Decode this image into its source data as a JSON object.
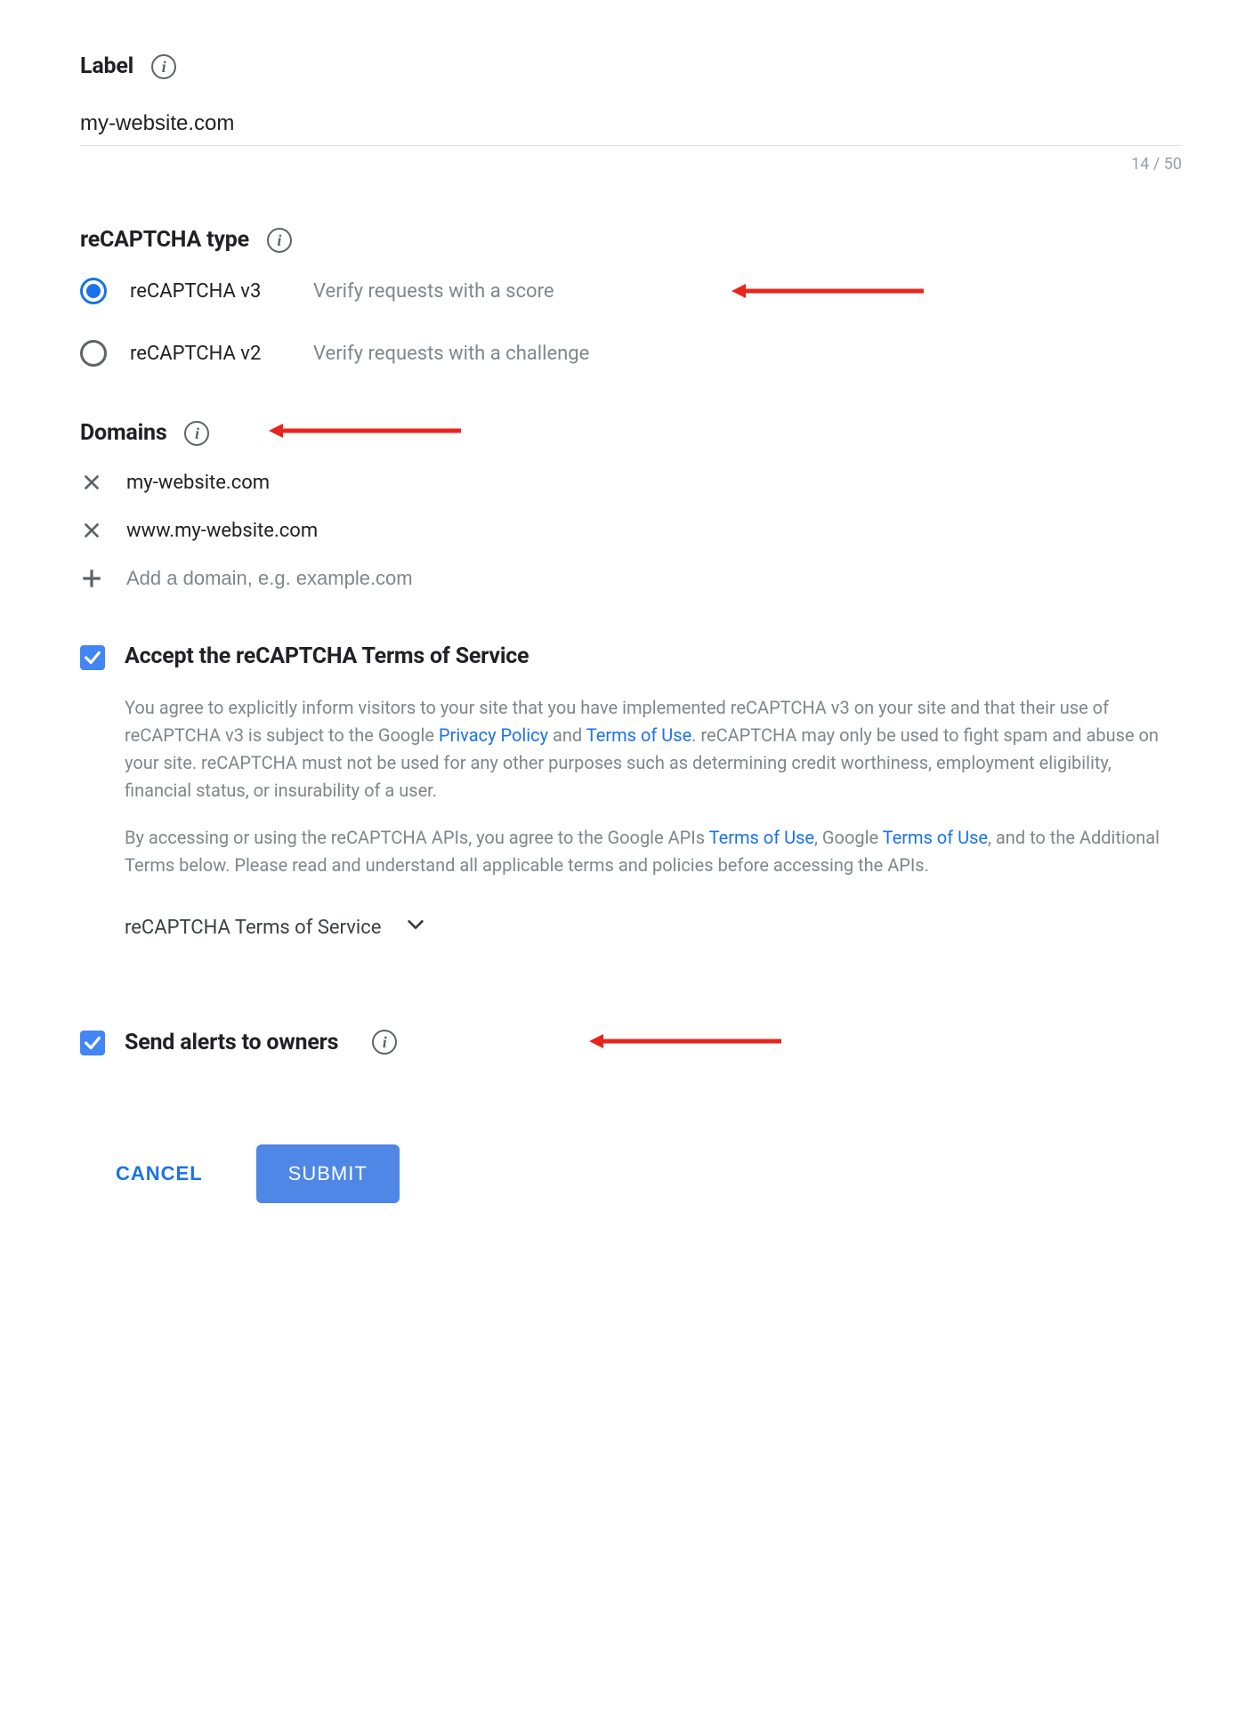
{
  "label": {
    "title": "Label",
    "value": "my-website.com",
    "char_count": "14 / 50"
  },
  "recaptcha_type": {
    "title": "reCAPTCHA type",
    "options": [
      {
        "label": "reCAPTCHA v3",
        "desc": "Verify requests with a score",
        "selected": true
      },
      {
        "label": "reCAPTCHA v2",
        "desc": "Verify requests with a challenge",
        "selected": false
      }
    ]
  },
  "domains": {
    "title": "Domains",
    "items": [
      "my-website.com",
      "www.my-website.com"
    ],
    "add_placeholder": "Add a domain, e.g. example.com"
  },
  "tos": {
    "checkbox_label": "Accept the reCAPTCHA Terms of Service",
    "p1_a": "You agree to explicitly inform visitors to your site that you have implemented reCAPTCHA v3 on your site and that their use of reCAPTCHA v3 is subject to the Google ",
    "p1_link1": "Privacy Policy",
    "p1_b": " and ",
    "p1_link2": "Terms of Use",
    "p1_c": ". reCAPTCHA may only be used to fight spam and abuse on your site. reCAPTCHA must not be used for any other purposes such as determining credit worthiness, employment eligibility, financial status, or insurability of a user.",
    "p2_a": "By accessing or using the reCAPTCHA APIs, you agree to the Google APIs ",
    "p2_link1": "Terms of Use",
    "p2_b": ", Google ",
    "p2_link2": "Terms of Use",
    "p2_c": ", and to the Additional Terms below. Please read and understand all applicable terms and policies before accessing the APIs.",
    "expand_label": "reCAPTCHA Terms of Service"
  },
  "alerts": {
    "label": "Send alerts to owners"
  },
  "buttons": {
    "cancel": "CANCEL",
    "submit": "SUBMIT"
  }
}
